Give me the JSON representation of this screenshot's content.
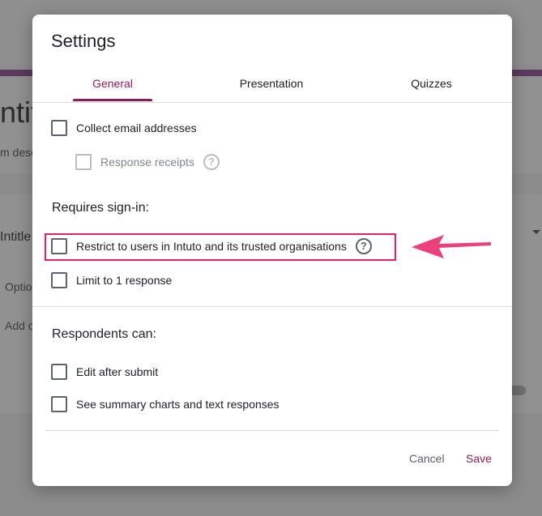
{
  "background": {
    "title_fragment": "ntit",
    "description_fragment": "m desc",
    "question_fragment": "Intitle",
    "option_fragment": "Optio",
    "add_fragment": "Add c"
  },
  "dialog": {
    "title": "Settings",
    "tabs": [
      {
        "label": "General",
        "active": true
      },
      {
        "label": "Presentation",
        "active": false
      },
      {
        "label": "Quizzes",
        "active": false
      }
    ],
    "options": {
      "collect_email": {
        "label": "Collect email addresses",
        "checked": false
      },
      "response_receipts": {
        "label": "Response receipts",
        "checked": false,
        "disabled": true,
        "help_icon": "help-circle-icon"
      }
    },
    "requires_signin": {
      "heading": "Requires sign-in:",
      "restrict": {
        "label": "Restrict to users in Intuto and its trusted organisations",
        "checked": false,
        "help_icon": "help-circle-icon"
      },
      "limit": {
        "label": "Limit to 1 response",
        "checked": false
      }
    },
    "respondents": {
      "heading": "Respondents can:",
      "edit_after": {
        "label": "Edit after submit",
        "checked": false
      },
      "see_summary": {
        "label": "See summary charts and text responses",
        "checked": false
      }
    },
    "buttons": {
      "cancel": "Cancel",
      "save": "Save"
    }
  },
  "colors": {
    "accent": "#8e1b59",
    "highlight": "#e91e63",
    "arrow": "#ec407a"
  }
}
